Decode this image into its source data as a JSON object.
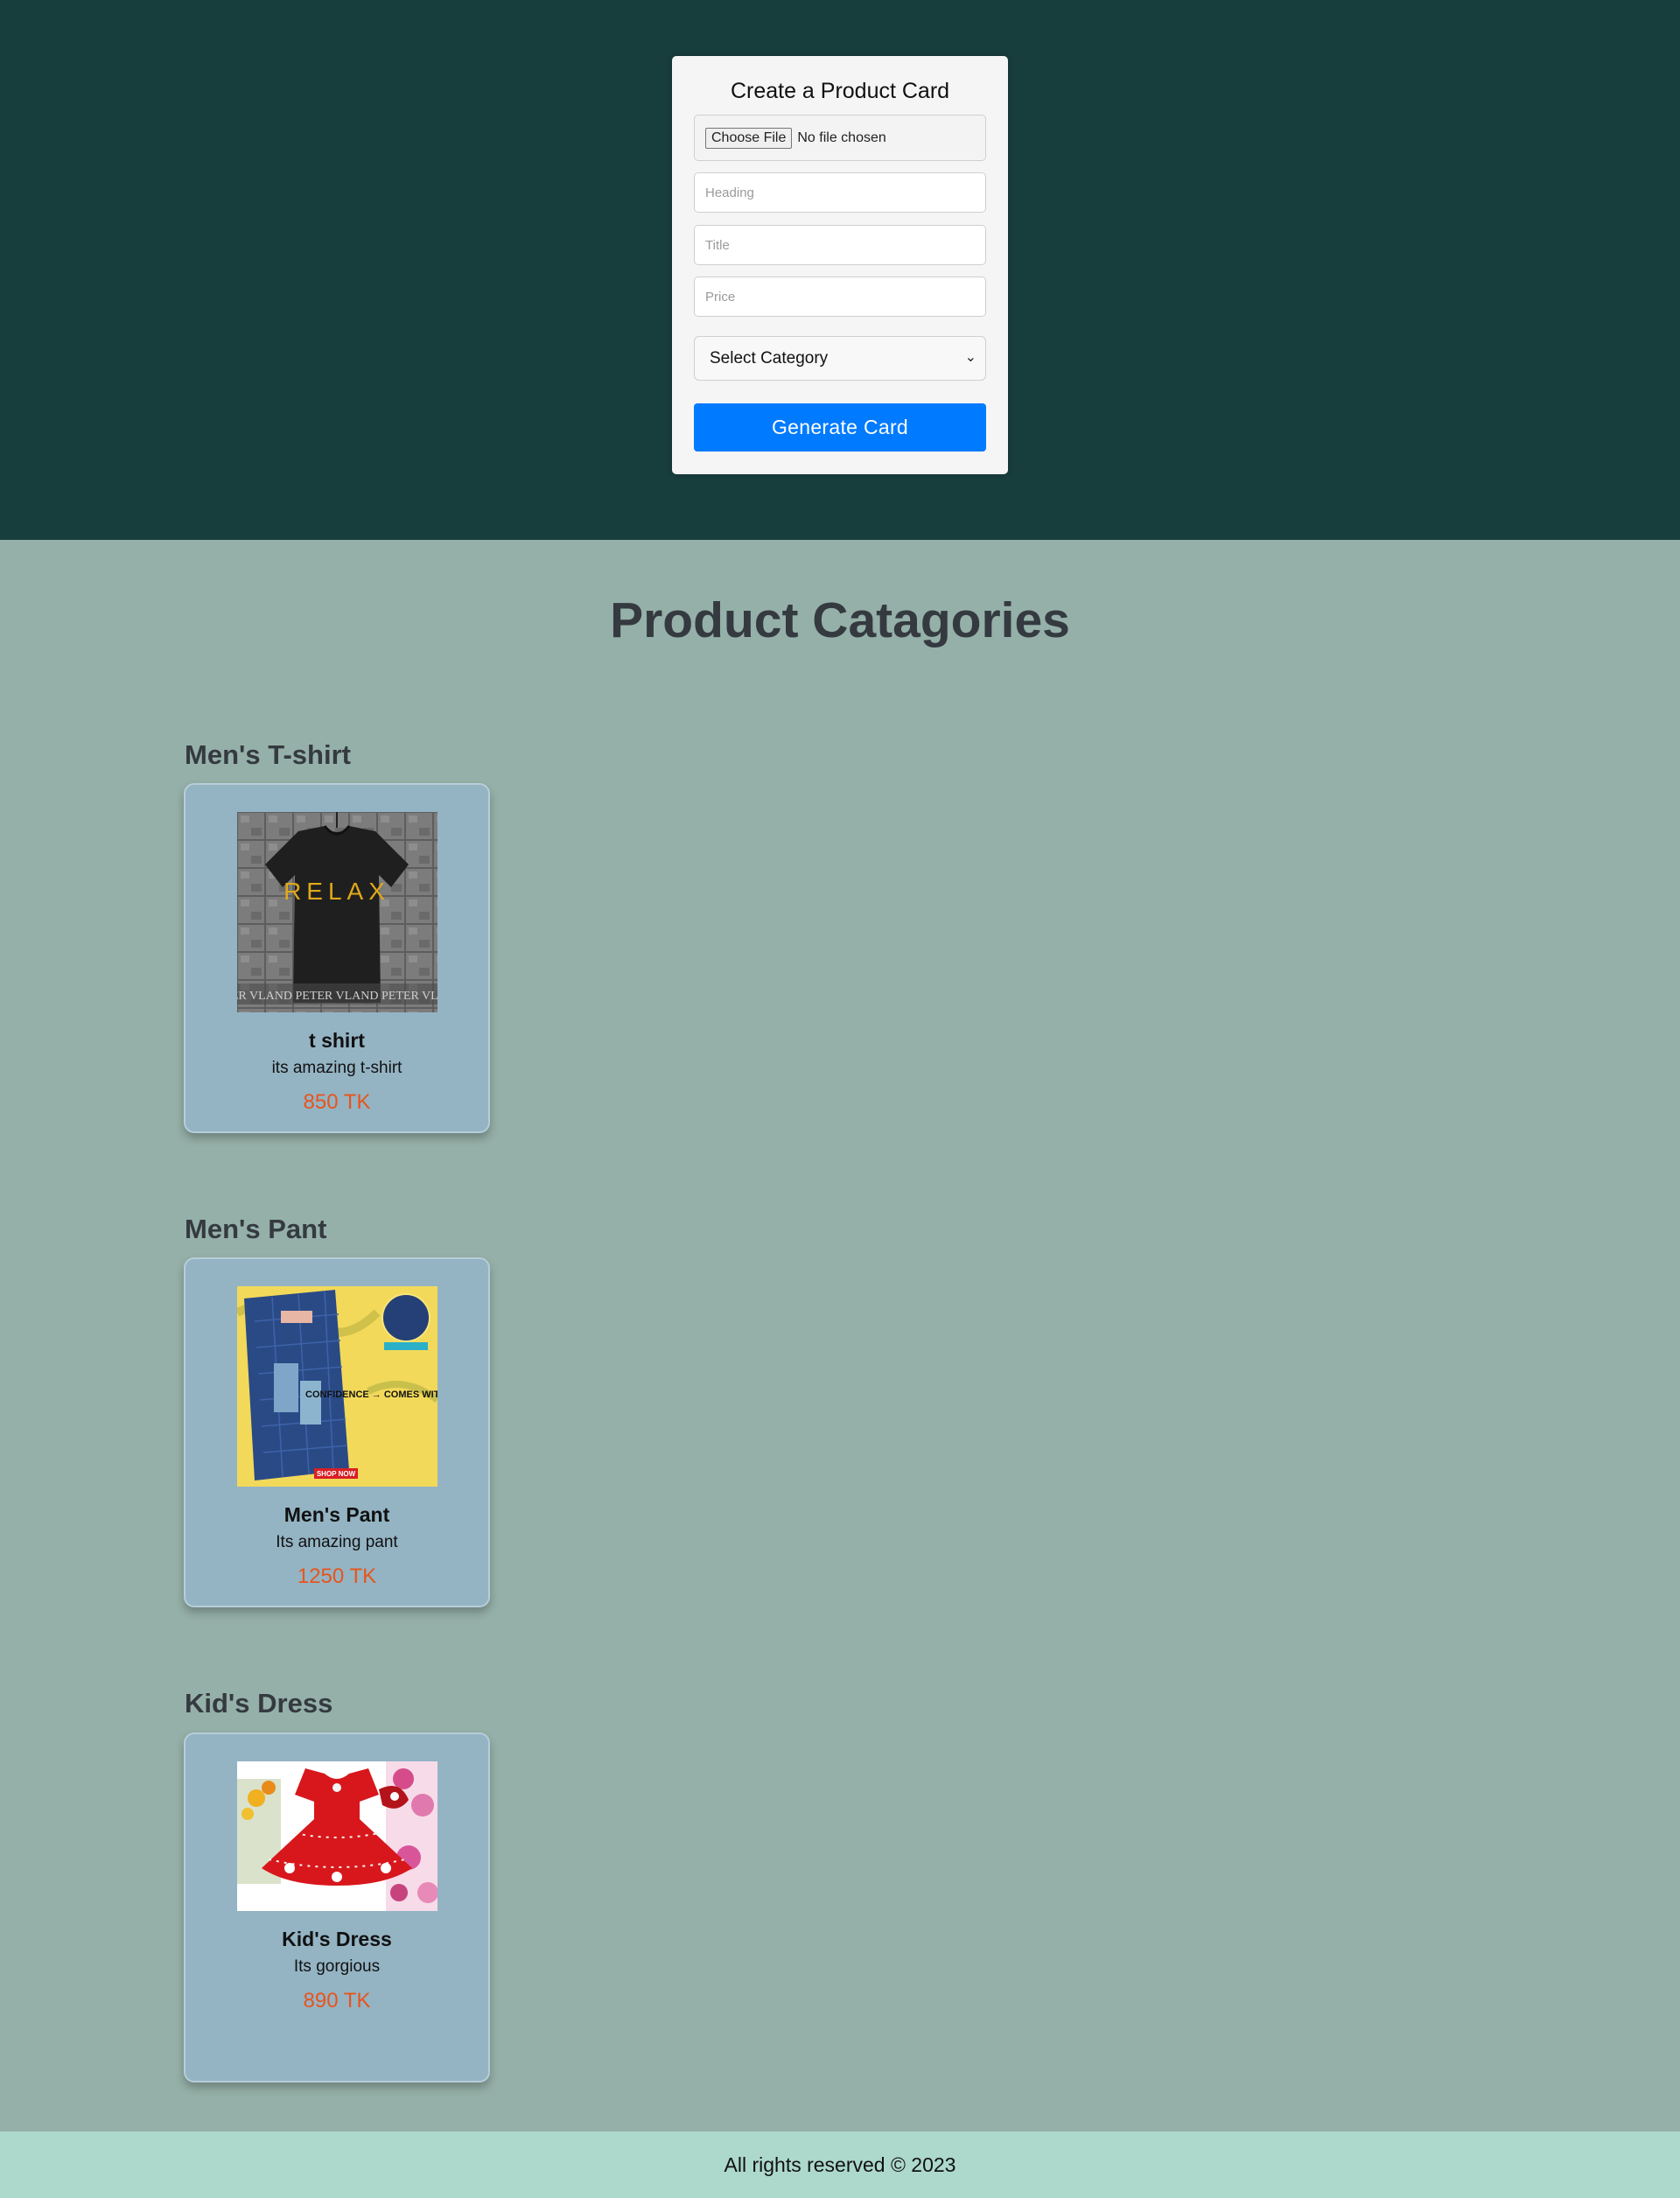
{
  "form": {
    "title": "Create a Product Card",
    "file_button": "Choose File",
    "file_status": "No file chosen",
    "heading_placeholder": "Heading",
    "title_placeholder": "Title",
    "price_placeholder": "Price",
    "category_select": "Select Category",
    "generate_button": "Generate Card"
  },
  "categories": {
    "page_title": "Product Catagories",
    "sections": [
      {
        "name": "Men's T-shirt",
        "card": {
          "heading": "t shirt",
          "title": "its amazing t-shirt",
          "price": "850 TK",
          "image_alt": "t-shirt product photo",
          "image_text": "RELAX",
          "image_watermark": "PETER VLAND PETER VLAND PETER VLAND"
        }
      },
      {
        "name": "Men's Pant",
        "card": {
          "heading": "Men's Pant",
          "title": "Its amazing pant",
          "price": "1250 TK",
          "image_alt": "pant product photo",
          "image_text": "CONFIDENCE → COMES WITH COMFORT",
          "image_badge": "SHOP NOW"
        }
      },
      {
        "name": "Kid's Dress",
        "card": {
          "heading": "Kid's Dress",
          "title": "Its gorgious",
          "price": "890 TK",
          "image_alt": "kid's dress product photo"
        }
      }
    ]
  },
  "footer": {
    "text": "All rights reserved © 2023"
  },
  "colors": {
    "header_bg": "#183d3d",
    "body_bg": "#95b0a8",
    "card_bg": "#94b4c4",
    "accent_button": "#007bff",
    "price": "#e8541c",
    "footer_bg": "#add8cc"
  }
}
